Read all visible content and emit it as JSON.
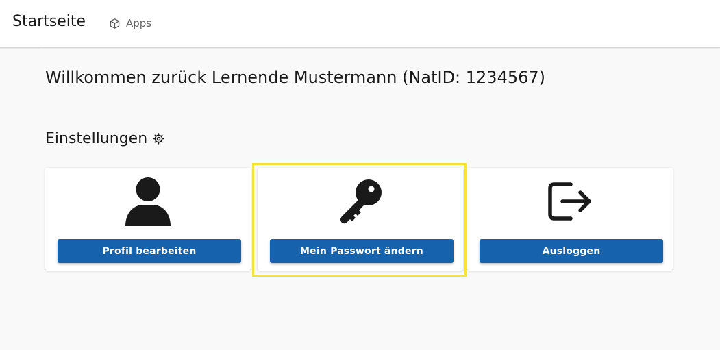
{
  "header": {
    "brand": "Startseite",
    "apps_label": "Apps",
    "apps_icon": "cube-icon"
  },
  "main": {
    "welcome": "Willkommen zurück Lernende Mustermann (NatID: 1234567)",
    "settings_title": "Einstellungen",
    "settings_icon": "gear-icon",
    "cards": [
      {
        "icon": "user-icon",
        "button": "Profil bearbeiten"
      },
      {
        "icon": "key-icon",
        "button": "Mein Passwort ändern"
      },
      {
        "icon": "logout-icon",
        "button": "Ausloggen"
      }
    ]
  },
  "colors": {
    "button": "#1762ad",
    "highlight": "#f5e33b",
    "background": "#f9f9f9"
  }
}
